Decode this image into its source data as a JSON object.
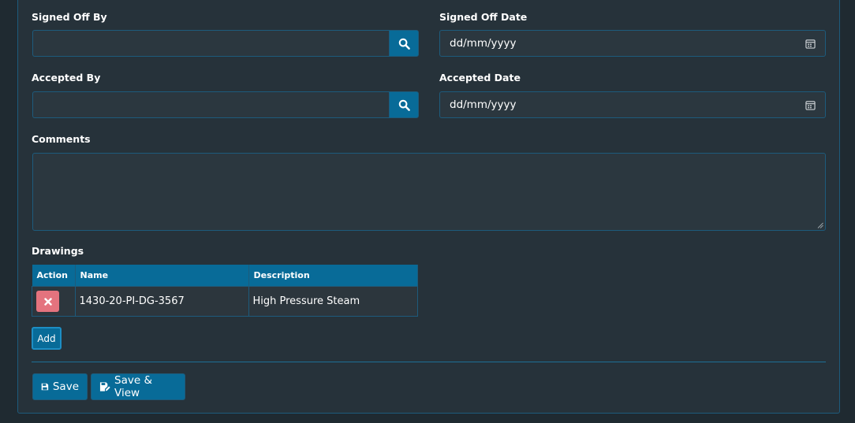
{
  "form": {
    "signed_off_by": {
      "label": "Signed Off By",
      "value": ""
    },
    "signed_off_date": {
      "label": "Signed Off Date",
      "placeholder": "dd/mm/yyyy"
    },
    "accepted_by": {
      "label": "Accepted By",
      "value": ""
    },
    "accepted_date": {
      "label": "Accepted Date",
      "placeholder": "dd/mm/yyyy"
    },
    "comments": {
      "label": "Comments",
      "value": ""
    }
  },
  "drawings": {
    "label": "Drawings",
    "columns": [
      "Action",
      "Name",
      "Description"
    ],
    "rows": [
      {
        "name": "1430-20-PI-DG-3567",
        "description": "High Pressure Steam"
      }
    ],
    "add_label": "Add"
  },
  "actions": {
    "save_label": "Save",
    "save_view_label": "Save & View"
  },
  "icons": {
    "search": "search-icon",
    "calendar": "calendar-icon",
    "delete": "close-icon",
    "save": "floppy-disk-icon",
    "save_view": "edit-document-icon"
  },
  "colors": {
    "primary": "#086b98",
    "danger": "#e4737e",
    "background": "#26323a",
    "border": "#1d5b7c"
  }
}
